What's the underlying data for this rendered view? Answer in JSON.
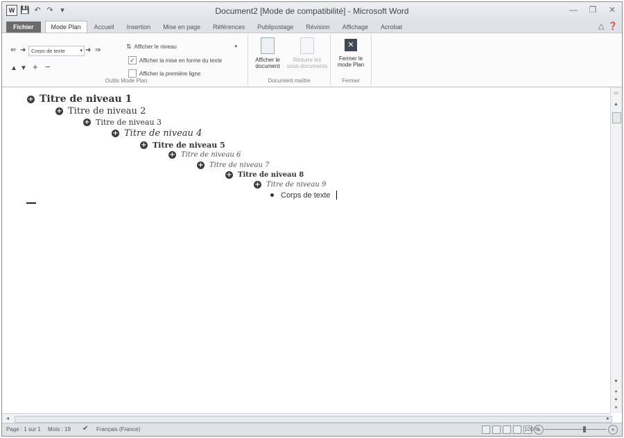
{
  "window": {
    "title": "Document2 [Mode de compatibilité] - Microsoft Word",
    "app_icon_letter": "W"
  },
  "quick_access": {
    "save": "💾",
    "undo": "↶",
    "redo": "↷"
  },
  "tabs": [
    "Fichier",
    "Mode Plan",
    "Accueil",
    "Insertion",
    "Mise en page",
    "Références",
    "Publipostage",
    "Révision",
    "Affichage",
    "Acrobat"
  ],
  "ribbon": {
    "outline_tools": {
      "level_value": "Corps de texte",
      "show_level_label": "Afficher le niveau",
      "show_formatting_label": "Afficher la mise en forme du texte",
      "show_formatting_checked": true,
      "first_line_only_label": "Afficher la première ligne",
      "first_line_only_checked": false,
      "group_label": "Outils Mode Plan"
    },
    "master_document": {
      "show_document_label": "Afficher le document",
      "collapse_subdocs_label": "Réduire les sous-documents",
      "group_label": "Document maître"
    },
    "close": {
      "close_outline_label": "Fermer le mode Plan",
      "group_label": "Fermer"
    }
  },
  "outline": [
    {
      "text": "Titre de niveau 1",
      "level": 1,
      "type": "heading"
    },
    {
      "text": "Titre de niveau 2",
      "level": 2,
      "type": "heading"
    },
    {
      "text": "Titre de niveau 3",
      "level": 3,
      "type": "heading"
    },
    {
      "text": "Titre de niveau 4",
      "level": 4,
      "type": "heading"
    },
    {
      "text": "Titre de niveau 5",
      "level": 5,
      "type": "heading"
    },
    {
      "text": "Titre de niveau 6",
      "level": 6,
      "type": "heading"
    },
    {
      "text": "Titre de niveau 7",
      "level": 7,
      "type": "heading"
    },
    {
      "text": "Titre de niveau 8",
      "level": 8,
      "type": "heading"
    },
    {
      "text": "Titre de niveau 9",
      "level": 9,
      "type": "heading"
    },
    {
      "text": "Corps de texte",
      "level": 10,
      "type": "body"
    }
  ],
  "status": {
    "page": "Page : 1 sur 1",
    "words": "Mots : 19",
    "language": "Français (France)",
    "zoom": "100 %"
  }
}
